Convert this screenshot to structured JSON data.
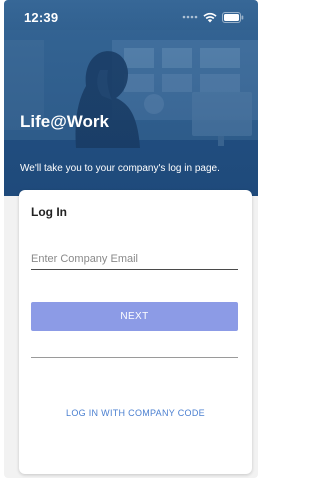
{
  "status_bar": {
    "time": "12:39",
    "icons": [
      "signal-dots-icon",
      "wifi-icon",
      "battery-icon"
    ]
  },
  "hero": {
    "app_title": "Life@Work",
    "subtitle": "We'll take you to your company's log in page."
  },
  "login_card": {
    "heading": "Log In",
    "email_field": {
      "placeholder": "Enter Company Email",
      "value": ""
    },
    "next_button_label": "NEXT",
    "company_code_link": "LOG IN WITH COMPANY CODE"
  },
  "colors": {
    "hero_blue": "#2f5f8e",
    "next_button": "#8c9be6",
    "link_blue": "#4a7fd0"
  }
}
